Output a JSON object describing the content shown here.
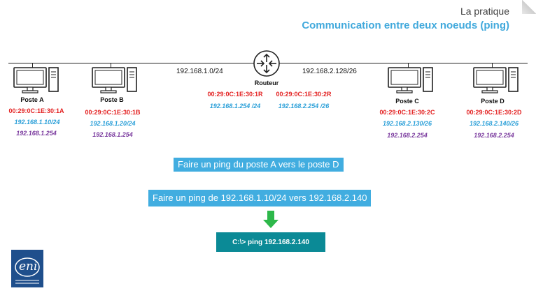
{
  "header": {
    "title": "La pratique",
    "subtitle": "Communication entre deux noeuds (ping)"
  },
  "networks": {
    "left": "192.168.1.0/24",
    "right": "192.168.2.128/26"
  },
  "router": {
    "name": "Routeur",
    "left_mac": "00:29:0C:1E:30:1R",
    "left_ip": "192.168.1.254 /24",
    "right_mac": "00:29:0C:1E:30:2R",
    "right_ip": "192.168.2.254 /26",
    "icon": "router-icon"
  },
  "stations": [
    {
      "name": "Poste A",
      "mac": "00:29:0C:1E:30:1A",
      "ip": "192.168.1.10/24",
      "gateway": "192.168.1.254"
    },
    {
      "name": "Poste B",
      "mac": "00:29:0C:1E:30:1B",
      "ip": "192.168.1.20/24",
      "gateway": "192.168.1.254"
    },
    {
      "name": "Poste C",
      "mac": "00:29:0C:1E:30:2C",
      "ip": "192.168.2.130/26",
      "gateway": "192.168.2.254"
    },
    {
      "name": "Poste D",
      "mac": "00:29:0C:1E:30:2D",
      "ip": "192.168.2.140/26",
      "gateway": "192.168.2.254"
    }
  ],
  "instructions": {
    "step1": "Faire un ping du poste A vers le poste D",
    "step2": "Faire un ping de 192.168.1.10/24 vers 192.168.2.140",
    "command": "C:\\> ping 192.168.2.140"
  },
  "logo": {
    "text": "eni",
    "icon": "eni-logo"
  },
  "colors": {
    "mac": "#e32020",
    "ip": "#2a9fd8",
    "gateway": "#7a3a9e",
    "callout": "#41ade0",
    "command": "#0b8a96",
    "arrow": "#2db84a",
    "logo": "#1f4f8c"
  }
}
